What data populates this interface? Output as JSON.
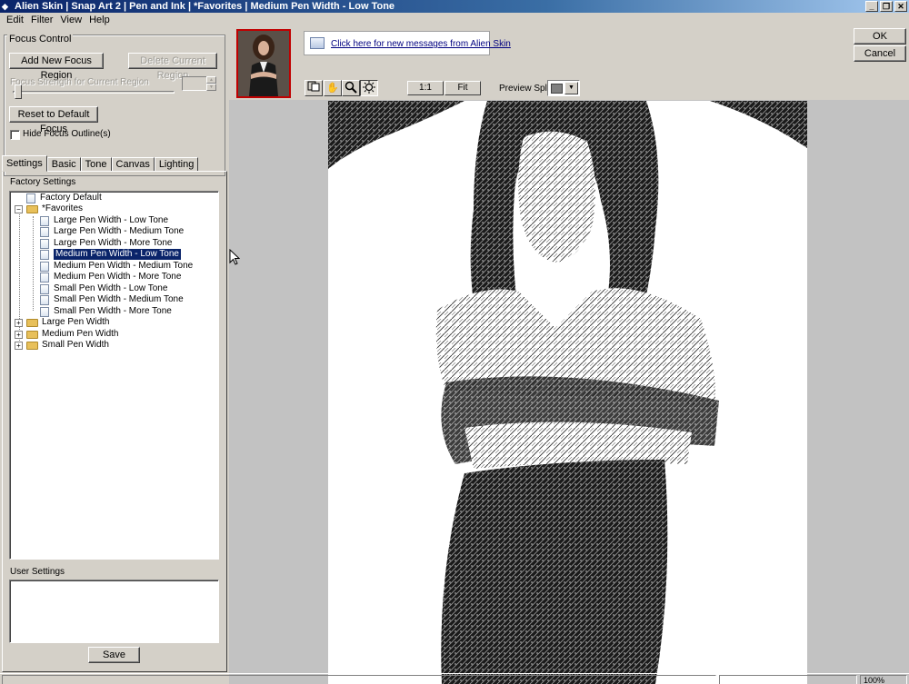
{
  "window": {
    "title": "Alien Skin | Snap Art 2 | Pen and Ink | *Favorites | Medium Pen Width - Low Tone",
    "minimize": "_",
    "restore": "❐",
    "close": "✕"
  },
  "menu": [
    "Edit",
    "Filter",
    "View",
    "Help"
  ],
  "focus_control": {
    "legend": "Focus Control",
    "add_button": "Add New Focus Region",
    "delete_button": "Delete Current Region",
    "strength_label": "Focus Strength for Current Region",
    "reset_button": "Reset to Default Focus",
    "hide_outline_label": "Hide Focus Outline(s)",
    "hide_outline_checked": false
  },
  "tabs": [
    "Settings",
    "Basic",
    "Tone",
    "Canvas",
    "Lighting"
  ],
  "settings": {
    "factory_label": "Factory Settings",
    "tree": [
      {
        "label": "Factory Default",
        "type": "doc",
        "level": 1
      },
      {
        "label": "*Favorites",
        "type": "folder",
        "level": 0,
        "expanded": true
      },
      {
        "label": "Large Pen Width - Low Tone",
        "type": "doc",
        "level": 2
      },
      {
        "label": "Large Pen Width - Medium Tone",
        "type": "doc",
        "level": 2
      },
      {
        "label": "Large Pen Width - More Tone",
        "type": "doc",
        "level": 2
      },
      {
        "label": "Medium Pen Width - Low Tone",
        "type": "doc",
        "level": 2,
        "selected": true
      },
      {
        "label": "Medium Pen Width - Medium Tone",
        "type": "doc",
        "level": 2
      },
      {
        "label": "Medium Pen Width - More Tone",
        "type": "doc",
        "level": 2
      },
      {
        "label": "Small Pen Width - Low Tone",
        "type": "doc",
        "level": 2
      },
      {
        "label": "Small Pen Width - Medium Tone",
        "type": "doc",
        "level": 2
      },
      {
        "label": "Small Pen Width - More Tone",
        "type": "doc",
        "level": 2
      },
      {
        "label": "Large Pen Width",
        "type": "folder",
        "level": 0,
        "expanded": false
      },
      {
        "label": "Medium Pen Width",
        "type": "folder",
        "level": 0,
        "expanded": false
      },
      {
        "label": "Small Pen Width",
        "type": "folder",
        "level": 0,
        "expanded": false
      }
    ],
    "user_label": "User Settings",
    "save_button": "Save"
  },
  "preview": {
    "message_link": "Click here for new messages from Alien Skin",
    "zoom_1to1": "1:1",
    "zoom_fit": "Fit",
    "split_label": "Preview Split:",
    "ok": "OK",
    "cancel": "Cancel"
  },
  "status": {
    "zoom": "100%"
  },
  "colors": {
    "selection": "#0a246a",
    "thumbnail_border": "#c00000"
  }
}
